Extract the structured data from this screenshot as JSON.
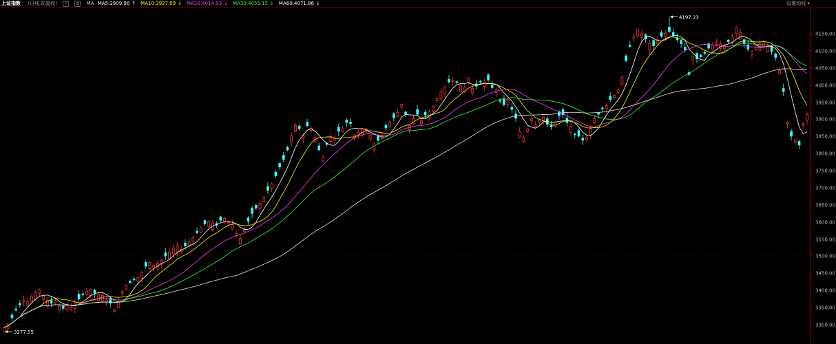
{
  "header": {
    "title": "上证指数",
    "subtitle": "(日线,前复权)",
    "help_glyph": "?",
    "gear_glyph": "⚙",
    "ma_label": "MA",
    "indicators": [
      {
        "name": "MA5",
        "value": "3909.96",
        "arrow": "↑",
        "color": "#ffffff"
      },
      {
        "name": "MA10",
        "value": "3927.09",
        "arrow": "↓",
        "color": "#ffff00"
      },
      {
        "name": "MA20",
        "value": "4014.93",
        "arrow": "↓",
        "color": "#ff3cff"
      },
      {
        "name": "MA30",
        "value": "4055.15",
        "arrow": "↓",
        "color": "#33ff33"
      },
      {
        "name": "MA60",
        "value": "4071.86",
        "arrow": "↓",
        "color": "#ffffff"
      }
    ],
    "settings_label": "设置均线 ▾"
  },
  "chart_data": {
    "type": "candlestick",
    "ylim": [
      3270,
      4220
    ],
    "yticks": [
      "4150.00",
      "4100.00",
      "4050.00",
      "4000.00",
      "3950.00",
      "3900.00",
      "3850.00",
      "3800.00",
      "3750.00",
      "3700.00",
      "3650.00",
      "3600.00",
      "3550.00",
      "3500.00",
      "3450.00",
      "3400.00",
      "3350.00",
      "3300.00"
    ],
    "high_annotation": "4197.23",
    "low_annotation": "3277.55",
    "high_value": 4197.23,
    "low_value": 3277.55,
    "colors": {
      "up": "#ff3333",
      "down": "#33ffff",
      "grid": "#8a0000",
      "axis_text": "#bbbbbb",
      "ma5": "#ffffff",
      "ma10": "#ffff00",
      "ma20": "#ff3cff",
      "ma30": "#33ff33",
      "ma60": "#e6e6e6"
    },
    "closes": [
      3290,
      3300,
      3318,
      3340,
      3355,
      3370,
      3365,
      3380,
      3392,
      3400,
      3382,
      3370,
      3360,
      3368,
      3352,
      3345,
      3358,
      3350,
      3362,
      3372,
      3385,
      3396,
      3402,
      3390,
      3386,
      3384,
      3370,
      3360,
      3342,
      3365,
      3395,
      3412,
      3420,
      3428,
      3436,
      3450,
      3468,
      3480,
      3472,
      3478,
      3486,
      3498,
      3510,
      3522,
      3530,
      3518,
      3528,
      3540,
      3552,
      3566,
      3580,
      3592,
      3600,
      3595,
      3588,
      3602,
      3608,
      3600,
      3590,
      3565,
      3550,
      3578,
      3600,
      3622,
      3638,
      3652,
      3668,
      3690,
      3710,
      3732,
      3758,
      3780,
      3808,
      3850,
      3880,
      3870,
      3852,
      3878,
      3872,
      3845,
      3808,
      3788,
      3824,
      3848,
      3842,
      3862,
      3870,
      3888,
      3885,
      3852,
      3860,
      3870,
      3870,
      3850,
      3826,
      3836,
      3850,
      3872,
      3888,
      3902,
      3918,
      3942,
      3912,
      3880,
      3900,
      3912,
      3895,
      3910,
      3920,
      3936,
      3958,
      3978,
      3992,
      4006,
      4012,
      4005,
      3998,
      3992,
      4018,
      3988,
      3994,
      4006,
      4010,
      4012,
      3990,
      3984,
      3950,
      3940,
      3956,
      3926,
      3900,
      3862,
      3845,
      3870,
      3900,
      3882,
      3896,
      3905,
      3883,
      3875,
      3890,
      3908,
      3911,
      3888,
      3878,
      3852,
      3848,
      3836,
      3845,
      3870,
      3900,
      3912,
      3928,
      3938,
      3955,
      3968,
      3984,
      4020,
      4068,
      4110,
      4140,
      4160,
      4148,
      4132,
      4120,
      4112,
      4130,
      4140,
      4150,
      4154,
      4142,
      4130,
      4118,
      4100,
      4028,
      4080,
      4074,
      4080,
      4090,
      4105,
      4115,
      4122,
      4118,
      4112,
      4124,
      4140,
      4165,
      4152,
      4118,
      4102,
      4096,
      4112,
      4118,
      4121,
      4110,
      4095,
      4078,
      4040,
      3978,
      3890,
      3848,
      3838,
      3822,
      3885,
      3912
    ]
  }
}
